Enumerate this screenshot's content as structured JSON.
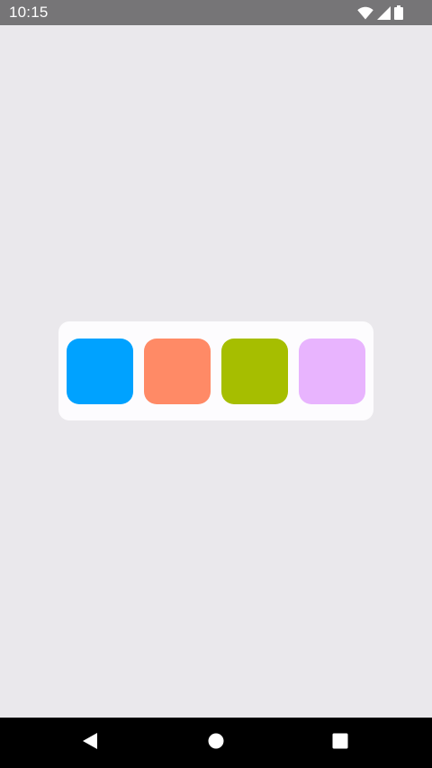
{
  "status_bar": {
    "time": "10:15",
    "icons": [
      "wifi-icon",
      "signal-icon",
      "battery-icon"
    ]
  },
  "palette": {
    "swatches": [
      {
        "color": "#00A2FF"
      },
      {
        "color": "#FF8A66"
      },
      {
        "color": "#A6BE00"
      },
      {
        "color": "#E8B4FE"
      }
    ]
  },
  "nav_bar": {
    "buttons": [
      "back-icon",
      "home-icon",
      "recents-icon"
    ]
  },
  "colors": {
    "status_bar": "#767577",
    "background": "#EAE8EC",
    "card": "#FDFCFE",
    "nav_bar": "#000000"
  }
}
